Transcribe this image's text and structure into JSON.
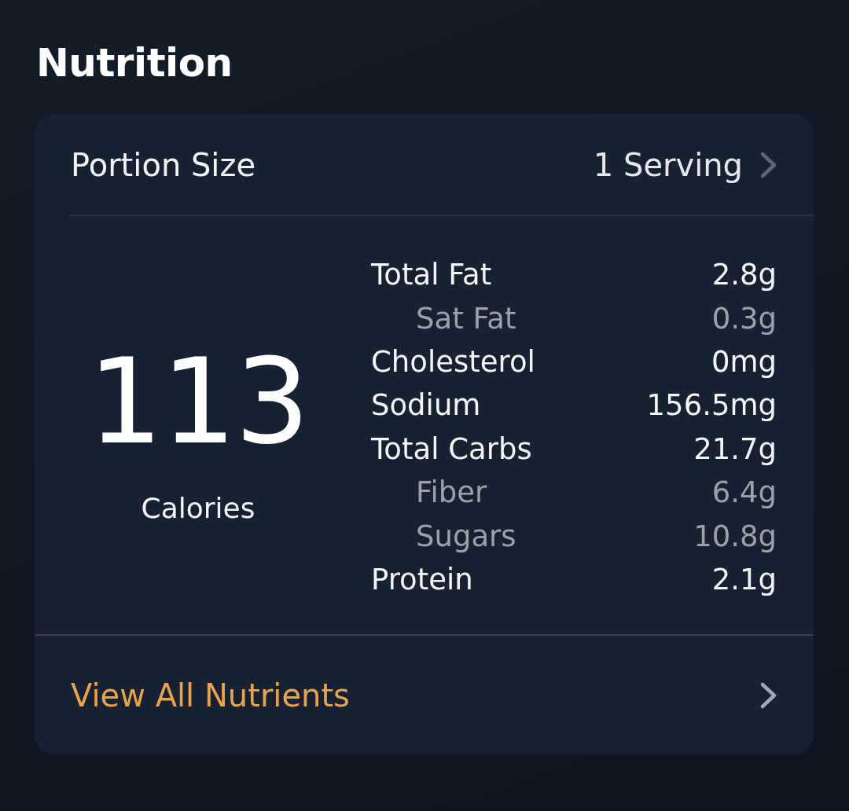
{
  "title": "Nutrition",
  "portion": {
    "label": "Portion Size",
    "value": "1 Serving"
  },
  "calories": {
    "value": "113",
    "label": "Calories"
  },
  "nutrients": [
    {
      "name": "Total Fat",
      "amount": "2.8g",
      "kind": "main"
    },
    {
      "name": "Sat Fat",
      "amount": "0.3g",
      "kind": "sub"
    },
    {
      "name": "Cholesterol",
      "amount": "0mg",
      "kind": "main"
    },
    {
      "name": "Sodium",
      "amount": "156.5mg",
      "kind": "main"
    },
    {
      "name": "Total Carbs",
      "amount": "21.7g",
      "kind": "main"
    },
    {
      "name": "Fiber",
      "amount": "6.4g",
      "kind": "sub"
    },
    {
      "name": "Sugars",
      "amount": "10.8g",
      "kind": "sub"
    },
    {
      "name": "Protein",
      "amount": "2.1g",
      "kind": "main"
    }
  ],
  "link": {
    "label": "View All Nutrients"
  }
}
